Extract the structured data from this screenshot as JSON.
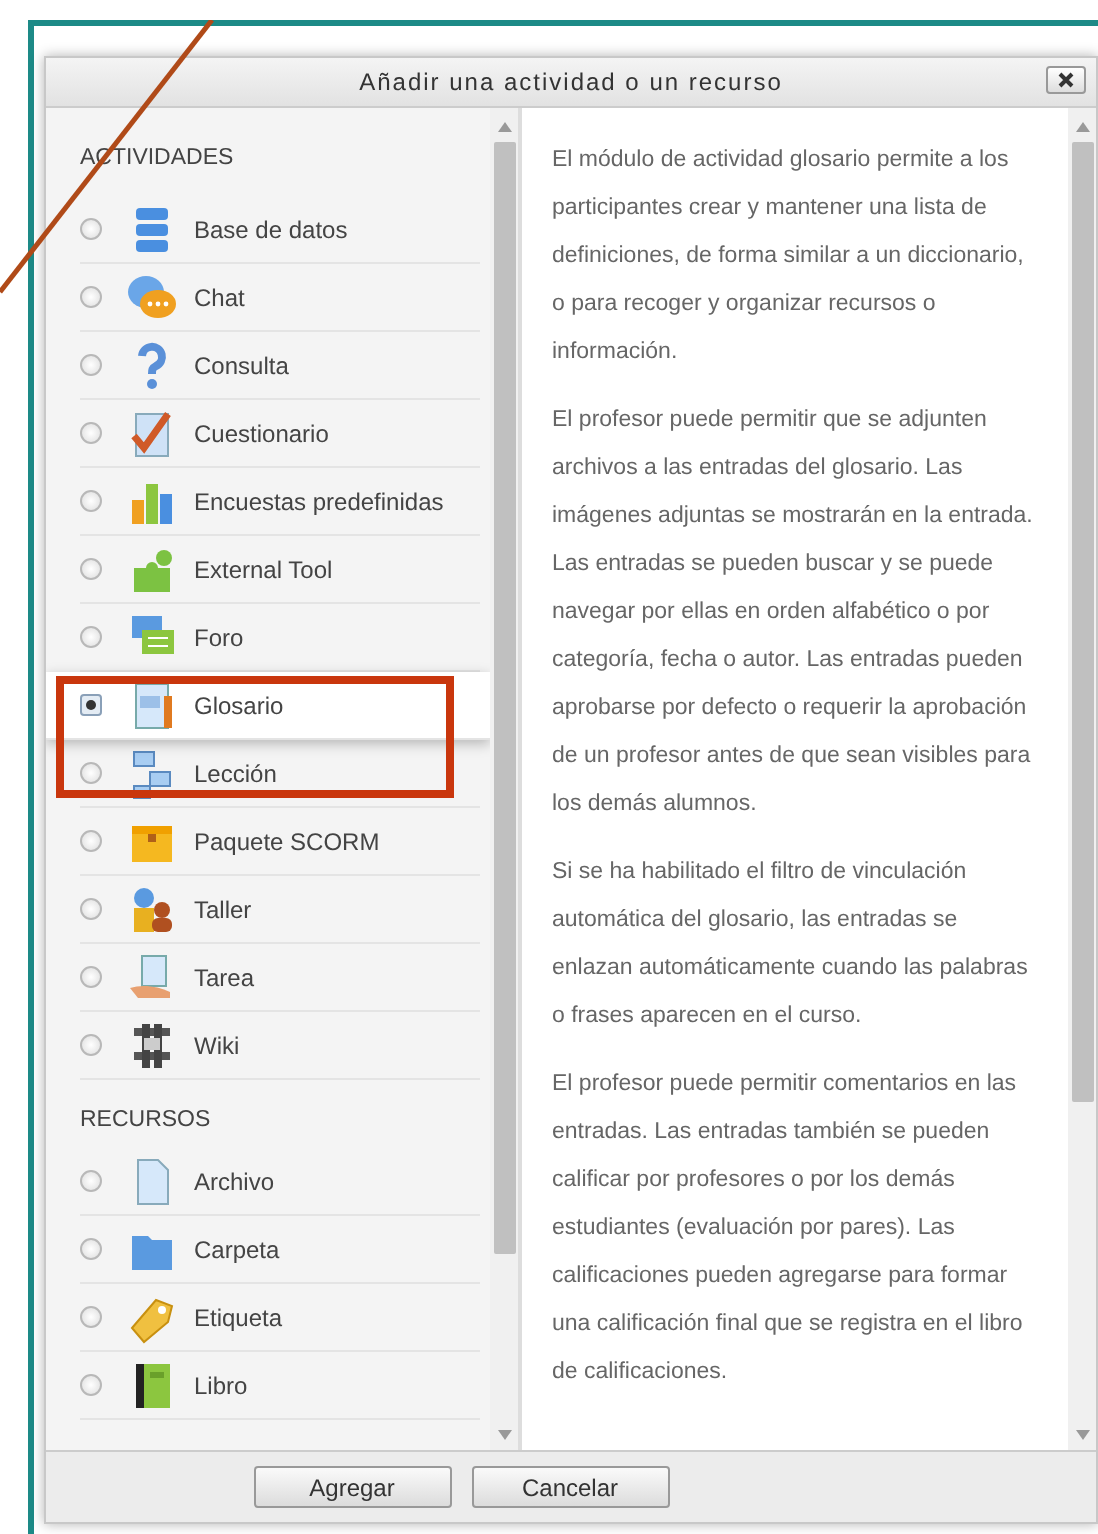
{
  "dialog": {
    "title": "Añadir una actividad o un recurso"
  },
  "sections": [
    {
      "heading": "ACTIVIDADES",
      "items": [
        {
          "label": "Base de datos",
          "selected": false
        },
        {
          "label": "Chat",
          "selected": false
        },
        {
          "label": "Consulta",
          "selected": false
        },
        {
          "label": "Cuestionario",
          "selected": false
        },
        {
          "label": "Encuestas predefinidas",
          "selected": false
        },
        {
          "label": "External Tool",
          "selected": false
        },
        {
          "label": "Foro",
          "selected": false
        },
        {
          "label": "Glosario",
          "selected": true
        },
        {
          "label": "Lección",
          "selected": false
        },
        {
          "label": "Paquete SCORM",
          "selected": false
        },
        {
          "label": "Taller",
          "selected": false
        },
        {
          "label": "Tarea",
          "selected": false
        },
        {
          "label": "Wiki",
          "selected": false
        }
      ]
    },
    {
      "heading": "RECURSOS",
      "items": [
        {
          "label": "Archivo",
          "selected": false
        },
        {
          "label": "Carpeta",
          "selected": false
        },
        {
          "label": "Etiqueta",
          "selected": false
        },
        {
          "label": "Libro",
          "selected": false
        }
      ]
    }
  ],
  "description": [
    "El módulo de actividad glosario permite a los participantes crear y mantener una lista de definiciones, de forma similar a un diccionario, o para recoger y organizar recursos o información.",
    "El profesor puede permitir que se adjunten archivos a las entradas del glosario. Las imágenes adjuntas se mostrarán en la entrada. Las entradas se pueden buscar y se puede navegar por ellas en orden alfabético o por categoría, fecha o autor. Las entradas pueden aprobarse por defecto o requerir la aprobación de un profesor antes de que sean visibles para los demás alumnos.",
    "Si se ha habilitado el filtro de vinculación automática del glosario, las entradas se enlazan automáticamente cuando las palabras o frases aparecen en el curso.",
    "El profesor puede permitir comentarios en las entradas. Las entradas también se pueden calificar por profesores o por los demás estudiantes (evaluación por pares). Las calificaciones pueden agregarse para formar una calificación final que se registra en el libro de calificaciones."
  ],
  "buttons": [
    "Agregar",
    "Cancelar"
  ]
}
